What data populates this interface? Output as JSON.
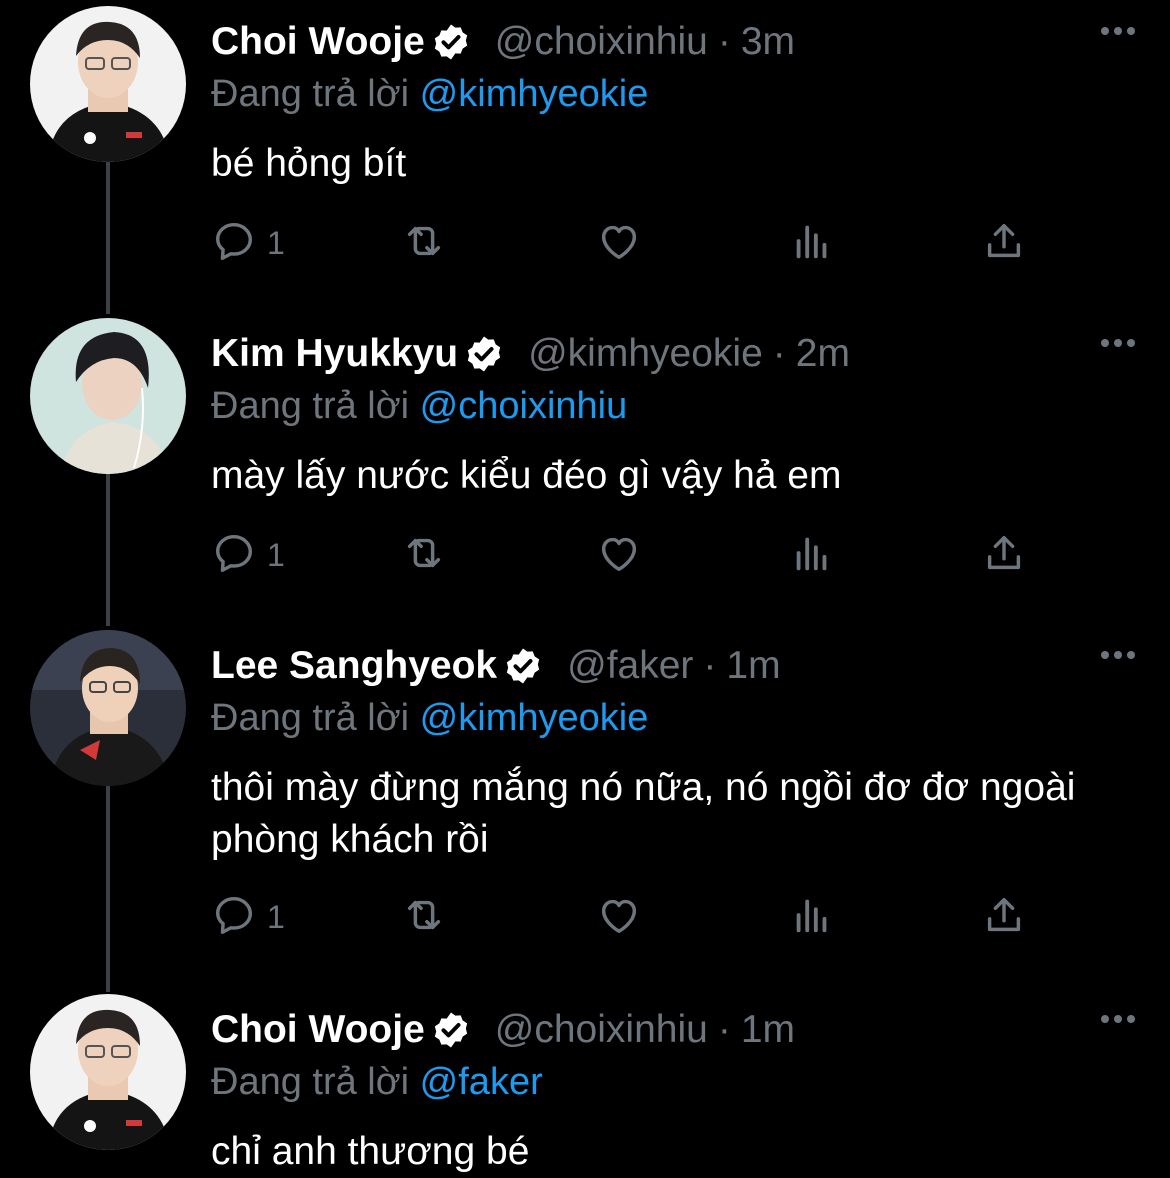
{
  "colors": {
    "background": "#000000",
    "primary_text": "#ffffff",
    "secondary_text": "#6e767d",
    "link": "#1d9bf0",
    "thread_line": "#3e4144"
  },
  "icons": {
    "verified": "verified-badge-icon",
    "more": "more-horizontal-icon",
    "reply": "reply-icon",
    "retweet": "retweet-icon",
    "like": "like-icon",
    "views": "views-icon",
    "share": "share-icon"
  },
  "tweets": [
    {
      "name": "Choi Wooje",
      "handle": "@choixinhiu",
      "dot": "·",
      "time": "3m",
      "reply_prefix": "Đang trả lời",
      "reply_to": "@kimhyeokie",
      "text": "bé hỏng bít",
      "reply_count": "1"
    },
    {
      "name": "Kim Hyukkyu",
      "handle": "@kimhyeokie",
      "dot": "·",
      "time": "2m",
      "reply_prefix": "Đang trả lời",
      "reply_to": "@choixinhiu",
      "text": "mày lấy nước kiểu đéo gì vậy hả em",
      "reply_count": "1"
    },
    {
      "name": "Lee Sanghyeok",
      "handle": "@faker",
      "dot": "·",
      "time": "1m",
      "reply_prefix": "Đang trả lời",
      "reply_to": "@kimhyeokie",
      "text": "thôi mày đừng mắng nó nữa, nó ngồi đơ đơ ngoài phòng khách rồi",
      "reply_count": "1"
    },
    {
      "name": "Choi Wooje",
      "handle": "@choixinhiu",
      "dot": "·",
      "time": "1m",
      "reply_prefix": "Đang trả lời",
      "reply_to": "@faker",
      "text": "chỉ anh thương bé"
    }
  ]
}
